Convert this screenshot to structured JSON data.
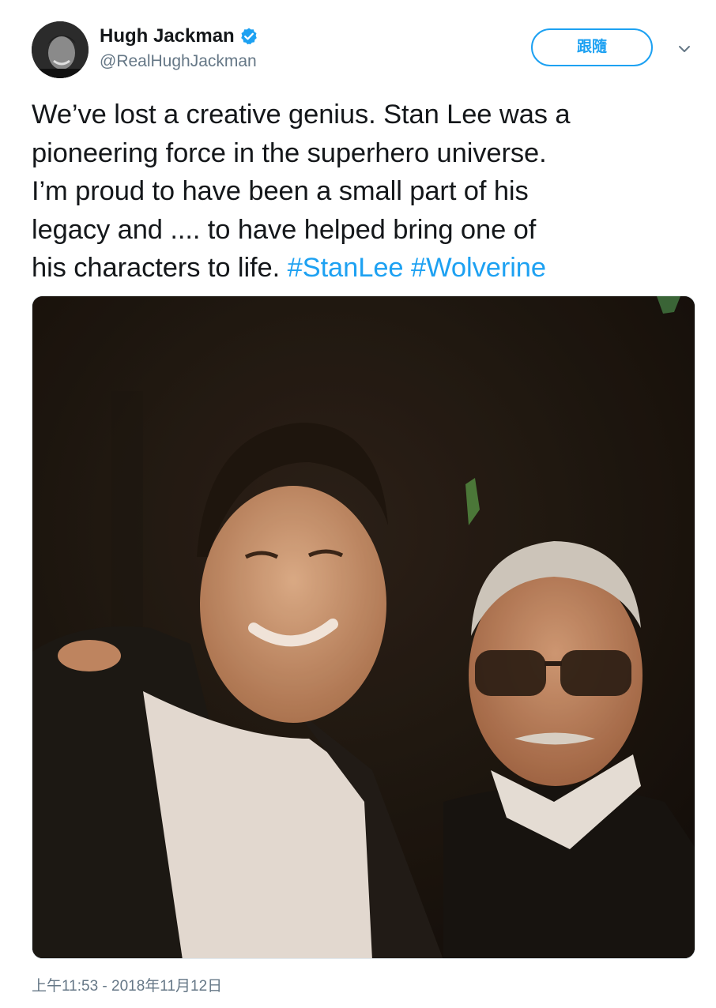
{
  "author": {
    "display_name": "Hugh Jackman",
    "handle": "@RealHughJackman",
    "verified": true,
    "avatar_icon": "avatar-photo"
  },
  "follow_button": {
    "label": "跟隨"
  },
  "menu": {
    "caret_icon": "chevron-down-icon"
  },
  "tweet": {
    "lines": [
      "We’ve lost a creative genius. Stan Lee was a",
      "pioneering force in the superhero universe.",
      "I’m proud to have been a small part of his",
      "legacy and .... to have helped bring one of",
      "his characters to life. "
    ],
    "hashtags": [
      "#StanLee",
      "#Wolverine"
    ]
  },
  "media": {
    "type": "photo"
  },
  "timestamp": "上午11:53 - 2018年11月12日",
  "colors": {
    "accent": "#1da1f2",
    "text": "#14171a",
    "secondary": "#657786"
  }
}
